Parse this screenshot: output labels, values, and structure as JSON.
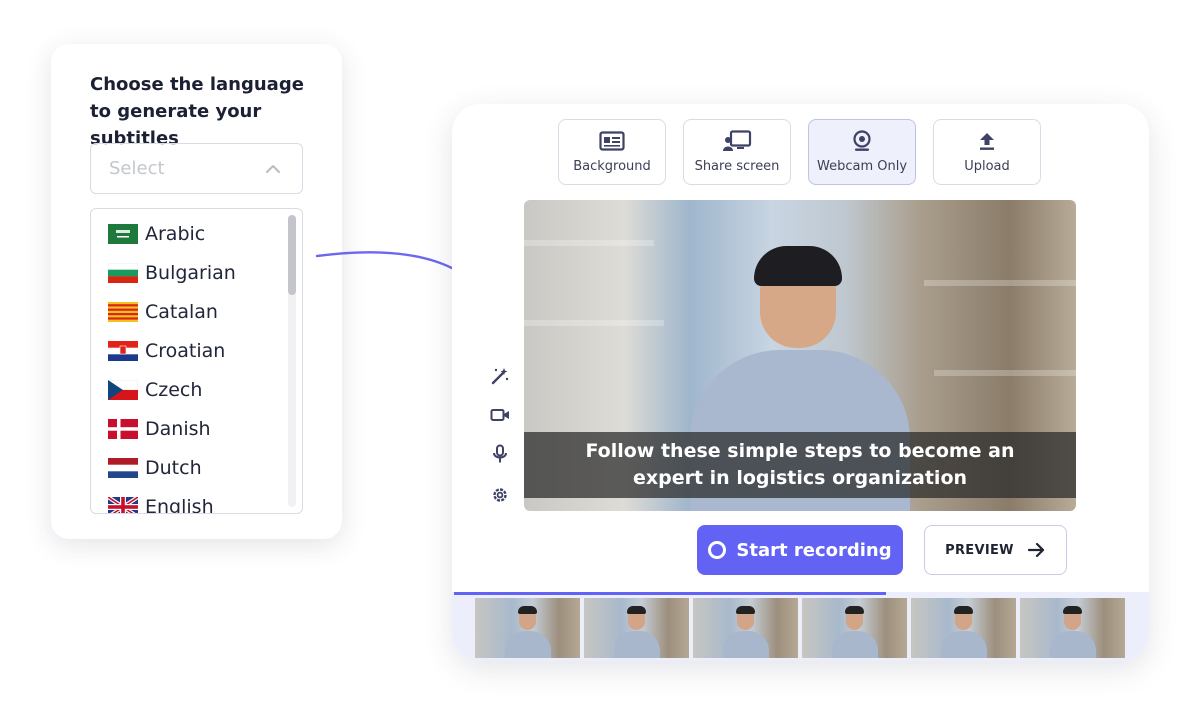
{
  "language_panel": {
    "title": "Choose the language to generate your subtitles",
    "select": {
      "placeholder": "Select",
      "icon": "chevron-up-icon"
    },
    "languages": [
      {
        "label": "Arabic",
        "flag": "saudi-arabia-flag"
      },
      {
        "label": "Bulgarian",
        "flag": "bulgaria-flag"
      },
      {
        "label": "Catalan",
        "flag": "catalonia-flag"
      },
      {
        "label": "Croatian",
        "flag": "croatia-flag"
      },
      {
        "label": "Czech",
        "flag": "czech-flag"
      },
      {
        "label": "Danish",
        "flag": "denmark-flag"
      },
      {
        "label": "Dutch",
        "flag": "netherlands-flag"
      },
      {
        "label": "English",
        "flag": "uk-flag"
      }
    ]
  },
  "recorder": {
    "toolbar": [
      {
        "label": "Background",
        "icon": "id-card-icon",
        "active": false
      },
      {
        "label": "Share screen",
        "icon": "share-screen-icon",
        "active": false
      },
      {
        "label": "Webcam Only",
        "icon": "webcam-icon",
        "active": true
      },
      {
        "label": "Upload",
        "icon": "upload-icon",
        "active": false
      }
    ],
    "side_tools": [
      "magic-wand-icon",
      "video-camera-icon",
      "microphone-icon",
      "gear-icon"
    ],
    "caption": "Follow these simple steps to become an expert in logistics organization",
    "start_button": "Start recording",
    "preview_button": "PREVIEW",
    "timeline_progress": 0.62,
    "thumbnail_count": 6
  },
  "colors": {
    "accent": "#6263f5",
    "timeline_bg": "#eceefb",
    "active_tool_bg": "#eef0fb",
    "arrow": "#6b68ef"
  }
}
